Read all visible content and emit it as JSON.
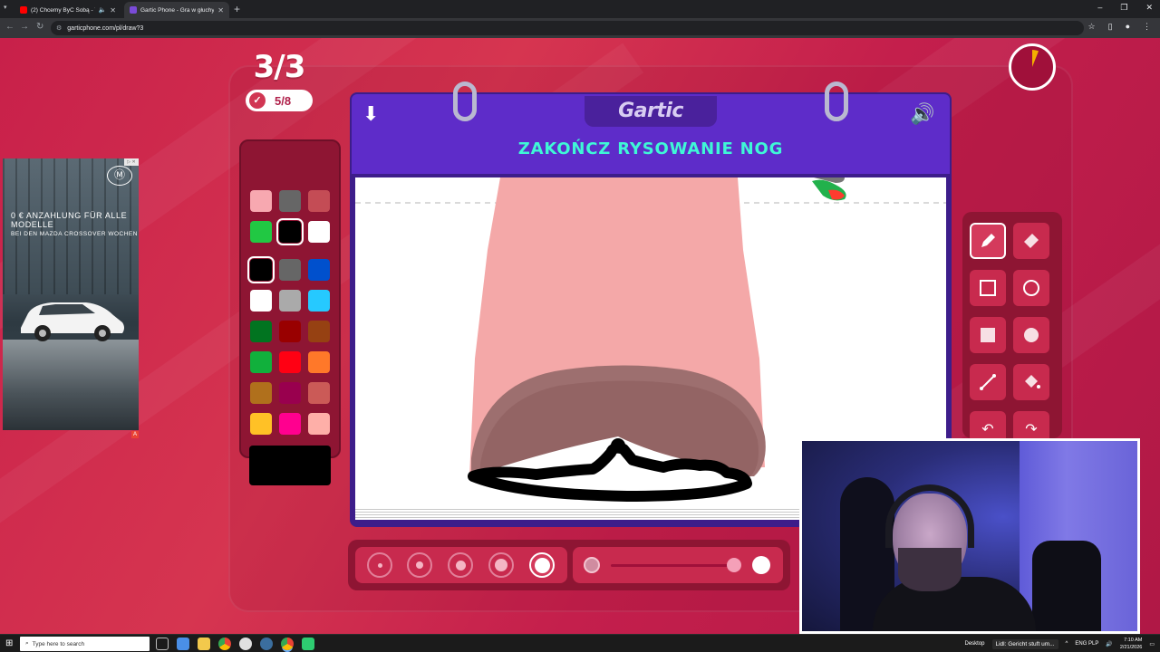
{
  "browser": {
    "tabs": [
      {
        "title": "(2) Chcemy ByĆ Sobą - You",
        "active": false,
        "favicon_color": "#ff0000"
      },
      {
        "title": "Gartic Phone - Gra w głuchy te",
        "active": true,
        "favicon_color": "#7a4bd8"
      }
    ],
    "url": "garticphone.com/pl/draw?3"
  },
  "game": {
    "round": "3/3",
    "done_count": "5/8",
    "logo": "Gartic",
    "prompt": "ZAKOŃCZ RYSOWANIE NOG",
    "timer_remaining_fraction": 0.93
  },
  "palette": {
    "top_colors": [
      "#f7a8b0",
      "#666666",
      "#c44c55",
      "#21c843",
      "#000000",
      "#ffffff"
    ],
    "top_selected_index": 4,
    "colors": [
      "#000000",
      "#666666",
      "#0050cd",
      "#ffffff",
      "#aaaaaa",
      "#26c9ff",
      "#017420",
      "#990000",
      "#964112",
      "#11b03c",
      "#ff0013",
      "#ff7829",
      "#b0701c",
      "#99004e",
      "#cb5a57",
      "#ffc126",
      "#ff008f",
      "#feafa8"
    ],
    "selected_index": 0,
    "current_color": "#000000"
  },
  "tools": [
    {
      "name": "pencil",
      "selected": true
    },
    {
      "name": "eraser",
      "selected": false
    },
    {
      "name": "rectangle-outline",
      "selected": false
    },
    {
      "name": "ellipse-outline",
      "selected": false
    },
    {
      "name": "rectangle-filled",
      "selected": false
    },
    {
      "name": "ellipse-filled",
      "selected": false
    },
    {
      "name": "line",
      "selected": false
    },
    {
      "name": "fill-bucket",
      "selected": false
    }
  ],
  "brush": {
    "sizes": [
      1,
      2,
      3,
      4,
      5
    ],
    "selected_size_index": 4,
    "opacity_fraction": 1.0
  },
  "ad": {
    "headline": "0 € ANZAHLUNG FÜR ALLE MODELLE",
    "sub": "BEI DEN MAZDA CROSSOVER WOCHEN"
  },
  "taskbar": {
    "search_placeholder": "Type here to search",
    "desktop_label": "Desktop",
    "notification": "Lidl: Gericht stuft um...",
    "lang": "ENG PLP",
    "time": "7:10 AM",
    "date": "2/21/2026"
  }
}
